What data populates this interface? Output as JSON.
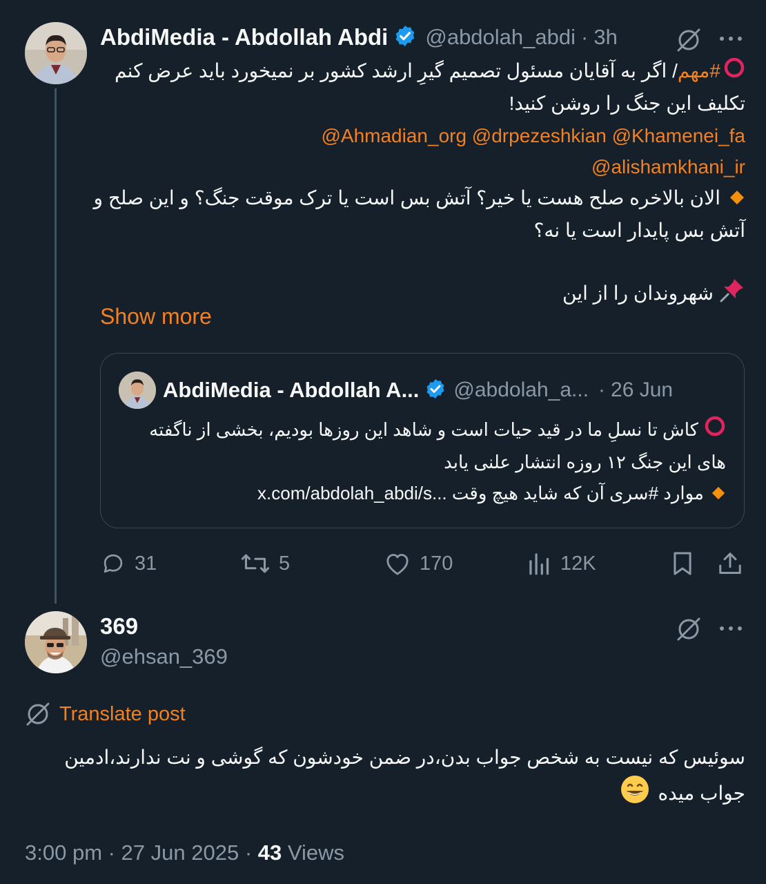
{
  "main_post": {
    "author_name": "AbdiMedia - Abdollah Abdi",
    "handle": "@abdolah_abdi",
    "time": "3h",
    "separator": "·",
    "hashtag": "#مهم",
    "line1_rest": "/ اگر به آقایان مسئول تصمیم گیرِ ارشد کشور بر نمیخورد باید عرض کنم",
    "line2": "تکلیف این جنگ را روشن کنید!",
    "mentions_line1": "@Ahmadian_org @drpezeshkian @Khamenei_fa",
    "mentions_line2": "@alishamkhani_ir",
    "bullet_line1": "الان بالاخره صلح هست یا خیر؟ آتش بس است یا ترک موقت جنگ؟ و این صلح و",
    "bullet_line2": "آتش بس پایدار است یا نه؟",
    "pin_line": "شهروندان را از این",
    "show_more": "Show more"
  },
  "quoted_post": {
    "author_name": "AbdiMedia - Abdollah A...",
    "handle": "@abdolah_a...",
    "separator": "·",
    "date": "26 Jun",
    "line1": "کاش تا نسلِ ما در قید حیات است و شاهد این روزها بودیم، بخشی از ناگفته",
    "line2": "های این جنگ ۱۲ روزه انتشار علنی یابد",
    "line3_text": "موارد #سری آن که شاید هیچ وقت",
    "line3_link": "x.com/abdolah_abdi/s..."
  },
  "actions": {
    "replies": "31",
    "reposts": "5",
    "likes": "170",
    "views": "12K"
  },
  "reply_post": {
    "author_name": "369",
    "handle": "@ehsan_369",
    "translate_label": "Translate post",
    "line1": "سوئیس که نیست به شخص جواب بدن،در ضمن خودشون که گوشی و نت ندارند،ادمین",
    "line2": "جواب میده",
    "timestamp": "3:00 pm · 27 Jun 2025 · ",
    "views_count": "43",
    "views_label": " Views"
  },
  "colors": {
    "background": "#15202b",
    "accent": "#f4801f",
    "muted": "#8b98a5",
    "verified": "#1d9bf0"
  },
  "icons": [
    "grok-icon",
    "more-icon",
    "verified-icon",
    "reply-icon",
    "repost-icon",
    "like-icon",
    "views-icon",
    "bookmark-icon",
    "share-icon",
    "translate-icon",
    "red-circle-icon",
    "diamond-icon",
    "pin-icon",
    "grin-emoji-icon"
  ]
}
